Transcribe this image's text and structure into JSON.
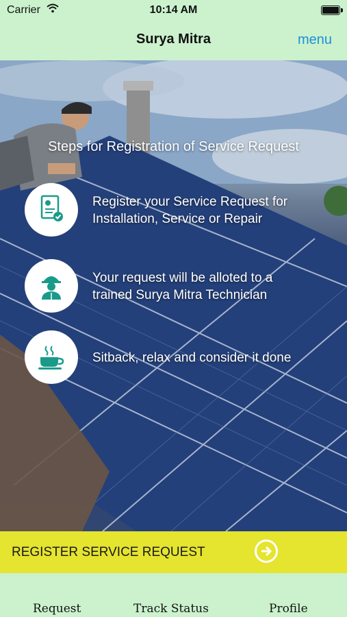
{
  "status_bar": {
    "carrier": "Carrier",
    "time": "10:14 AM"
  },
  "nav": {
    "title": "Surya Mitra",
    "menu_label": "menu"
  },
  "steps_title": "Steps for Registration of Service Request",
  "steps": [
    {
      "icon": "document-check-icon",
      "line1": "Register your Service Request for",
      "line2": "Installation, Service or Repair"
    },
    {
      "icon": "technician-icon",
      "line1": "Your request will be alloted to a",
      "line2": "trained Surya Mitra Technician"
    },
    {
      "icon": "coffee-cup-icon",
      "line1": "Sitback, relax and consider it done",
      "line2": ""
    }
  ],
  "register": {
    "label": "REGISTER SERVICE REQUEST",
    "icon": "arrow-right-circle-icon"
  },
  "tabs": [
    {
      "label": "Request"
    },
    {
      "label": "Track Status"
    },
    {
      "label": "Profile"
    }
  ],
  "colors": {
    "accent": "#1b8fd8",
    "nav_bg": "#cbf2cd",
    "register_bg": "#e5e42f",
    "icon_teal": "#1a9b8a"
  }
}
